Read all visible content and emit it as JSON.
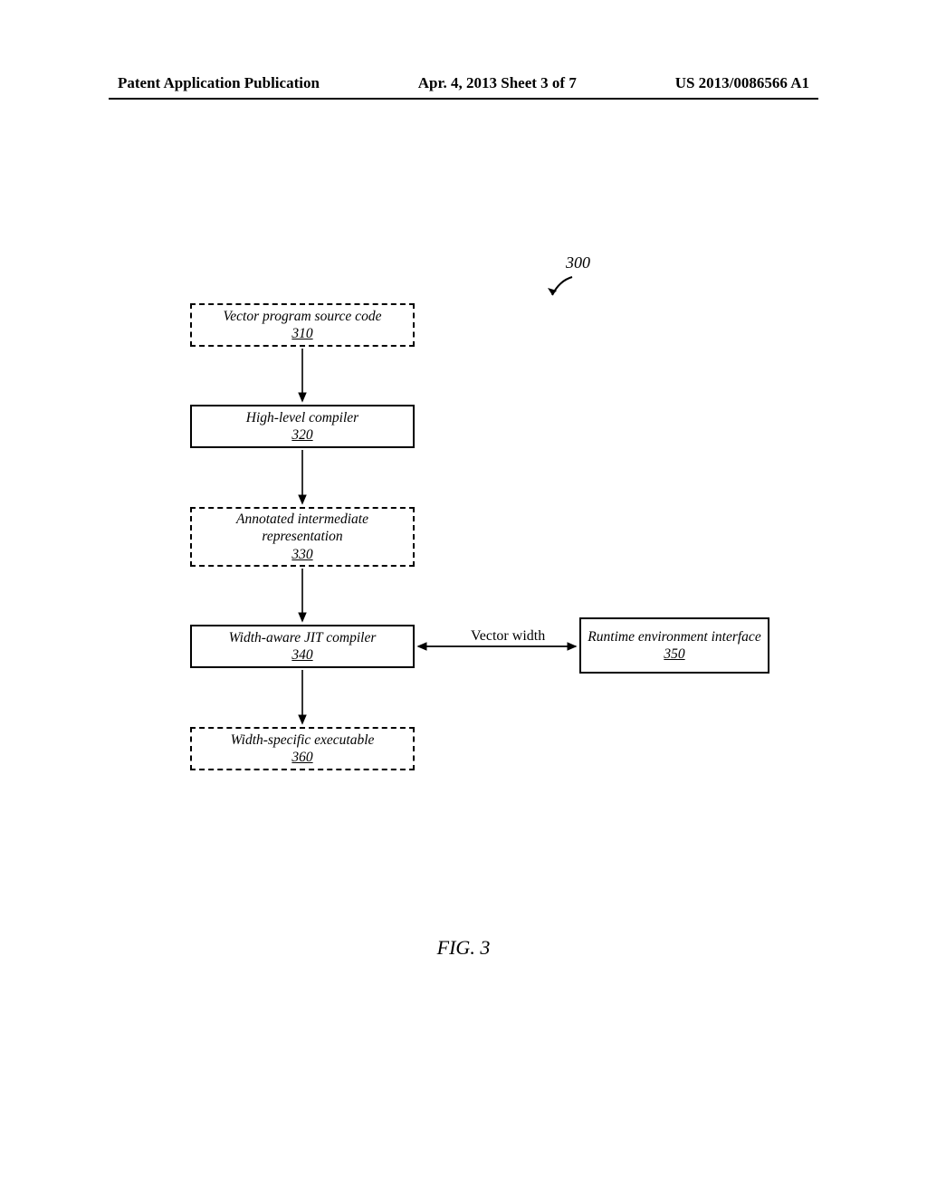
{
  "header": {
    "left": "Patent Application Publication",
    "center": "Apr. 4, 2013  Sheet 3 of 7",
    "right": "US 2013/0086566 A1"
  },
  "diagram": {
    "ref": "300",
    "boxes": {
      "b310": {
        "label": "Vector program source code",
        "num": "310"
      },
      "b320": {
        "label": "High-level compiler",
        "num": "320"
      },
      "b330": {
        "label": "Annotated intermediate representation",
        "num": "330"
      },
      "b340": {
        "label": "Width-aware JIT compiler",
        "num": "340"
      },
      "b350": {
        "label": "Runtime environment interface",
        "num": "350"
      },
      "b360": {
        "label": "Width-specific executable",
        "num": "360"
      }
    },
    "edge_label": "Vector width"
  },
  "figure_label": "FIG. 3"
}
